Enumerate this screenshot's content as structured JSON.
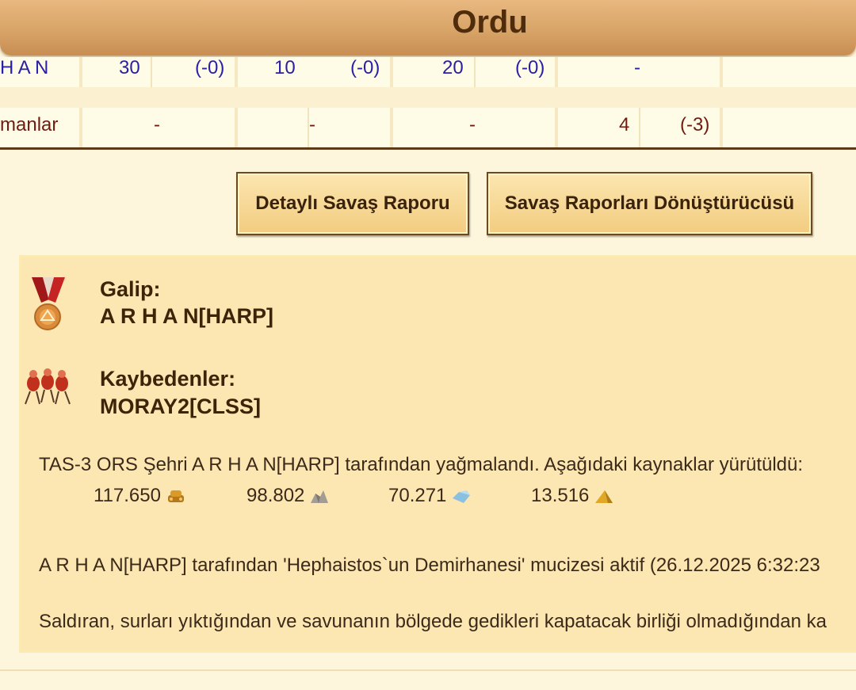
{
  "header": {
    "title": "Ordu"
  },
  "table": {
    "row1": {
      "name": "H A N",
      "cells": [
        "30",
        "(-0)",
        "10",
        "(-0)",
        "20",
        "(-0)",
        "-"
      ]
    },
    "row2": {
      "name": "manlar",
      "cells": [
        "-",
        "-",
        "-",
        "4",
        "(-3)"
      ]
    }
  },
  "buttons": {
    "detailed_report": "Detaylı Savaş Raporu",
    "converter": "Savaş Raporları Dönüştürücüsü"
  },
  "report": {
    "winner_label": "Galip:",
    "winner_name": "A R H A N[HARP]",
    "losers_label": "Kaybedenler:",
    "losers_name": "MORAY2[CLSS]",
    "plunder_text": "TAS-3 ORS Şehri A R H A N[HARP] tarafından yağmalandı. Aşağıdaki kaynaklar yürütüldü:",
    "resources": [
      {
        "value": "117.650",
        "icon": "wood-icon",
        "color": "#c98a1e"
      },
      {
        "value": "98.802",
        "icon": "stone-icon",
        "color": "#9a9490"
      },
      {
        "value": "70.271",
        "icon": "iron-icon",
        "color": "#7bb3d6"
      },
      {
        "value": "13.516",
        "icon": "gold-icon",
        "color": "#d9a520"
      }
    ],
    "wonder_text": "A R H A N[HARP] tarafından 'Hephaistos`un Demirhanesi' mucizesi aktif (26.12.2025 6:32:23",
    "walls_text": "Saldıran, surları yıktığından ve savunanın bölgede gedikleri kapatacak birliği olmadığından ka"
  }
}
